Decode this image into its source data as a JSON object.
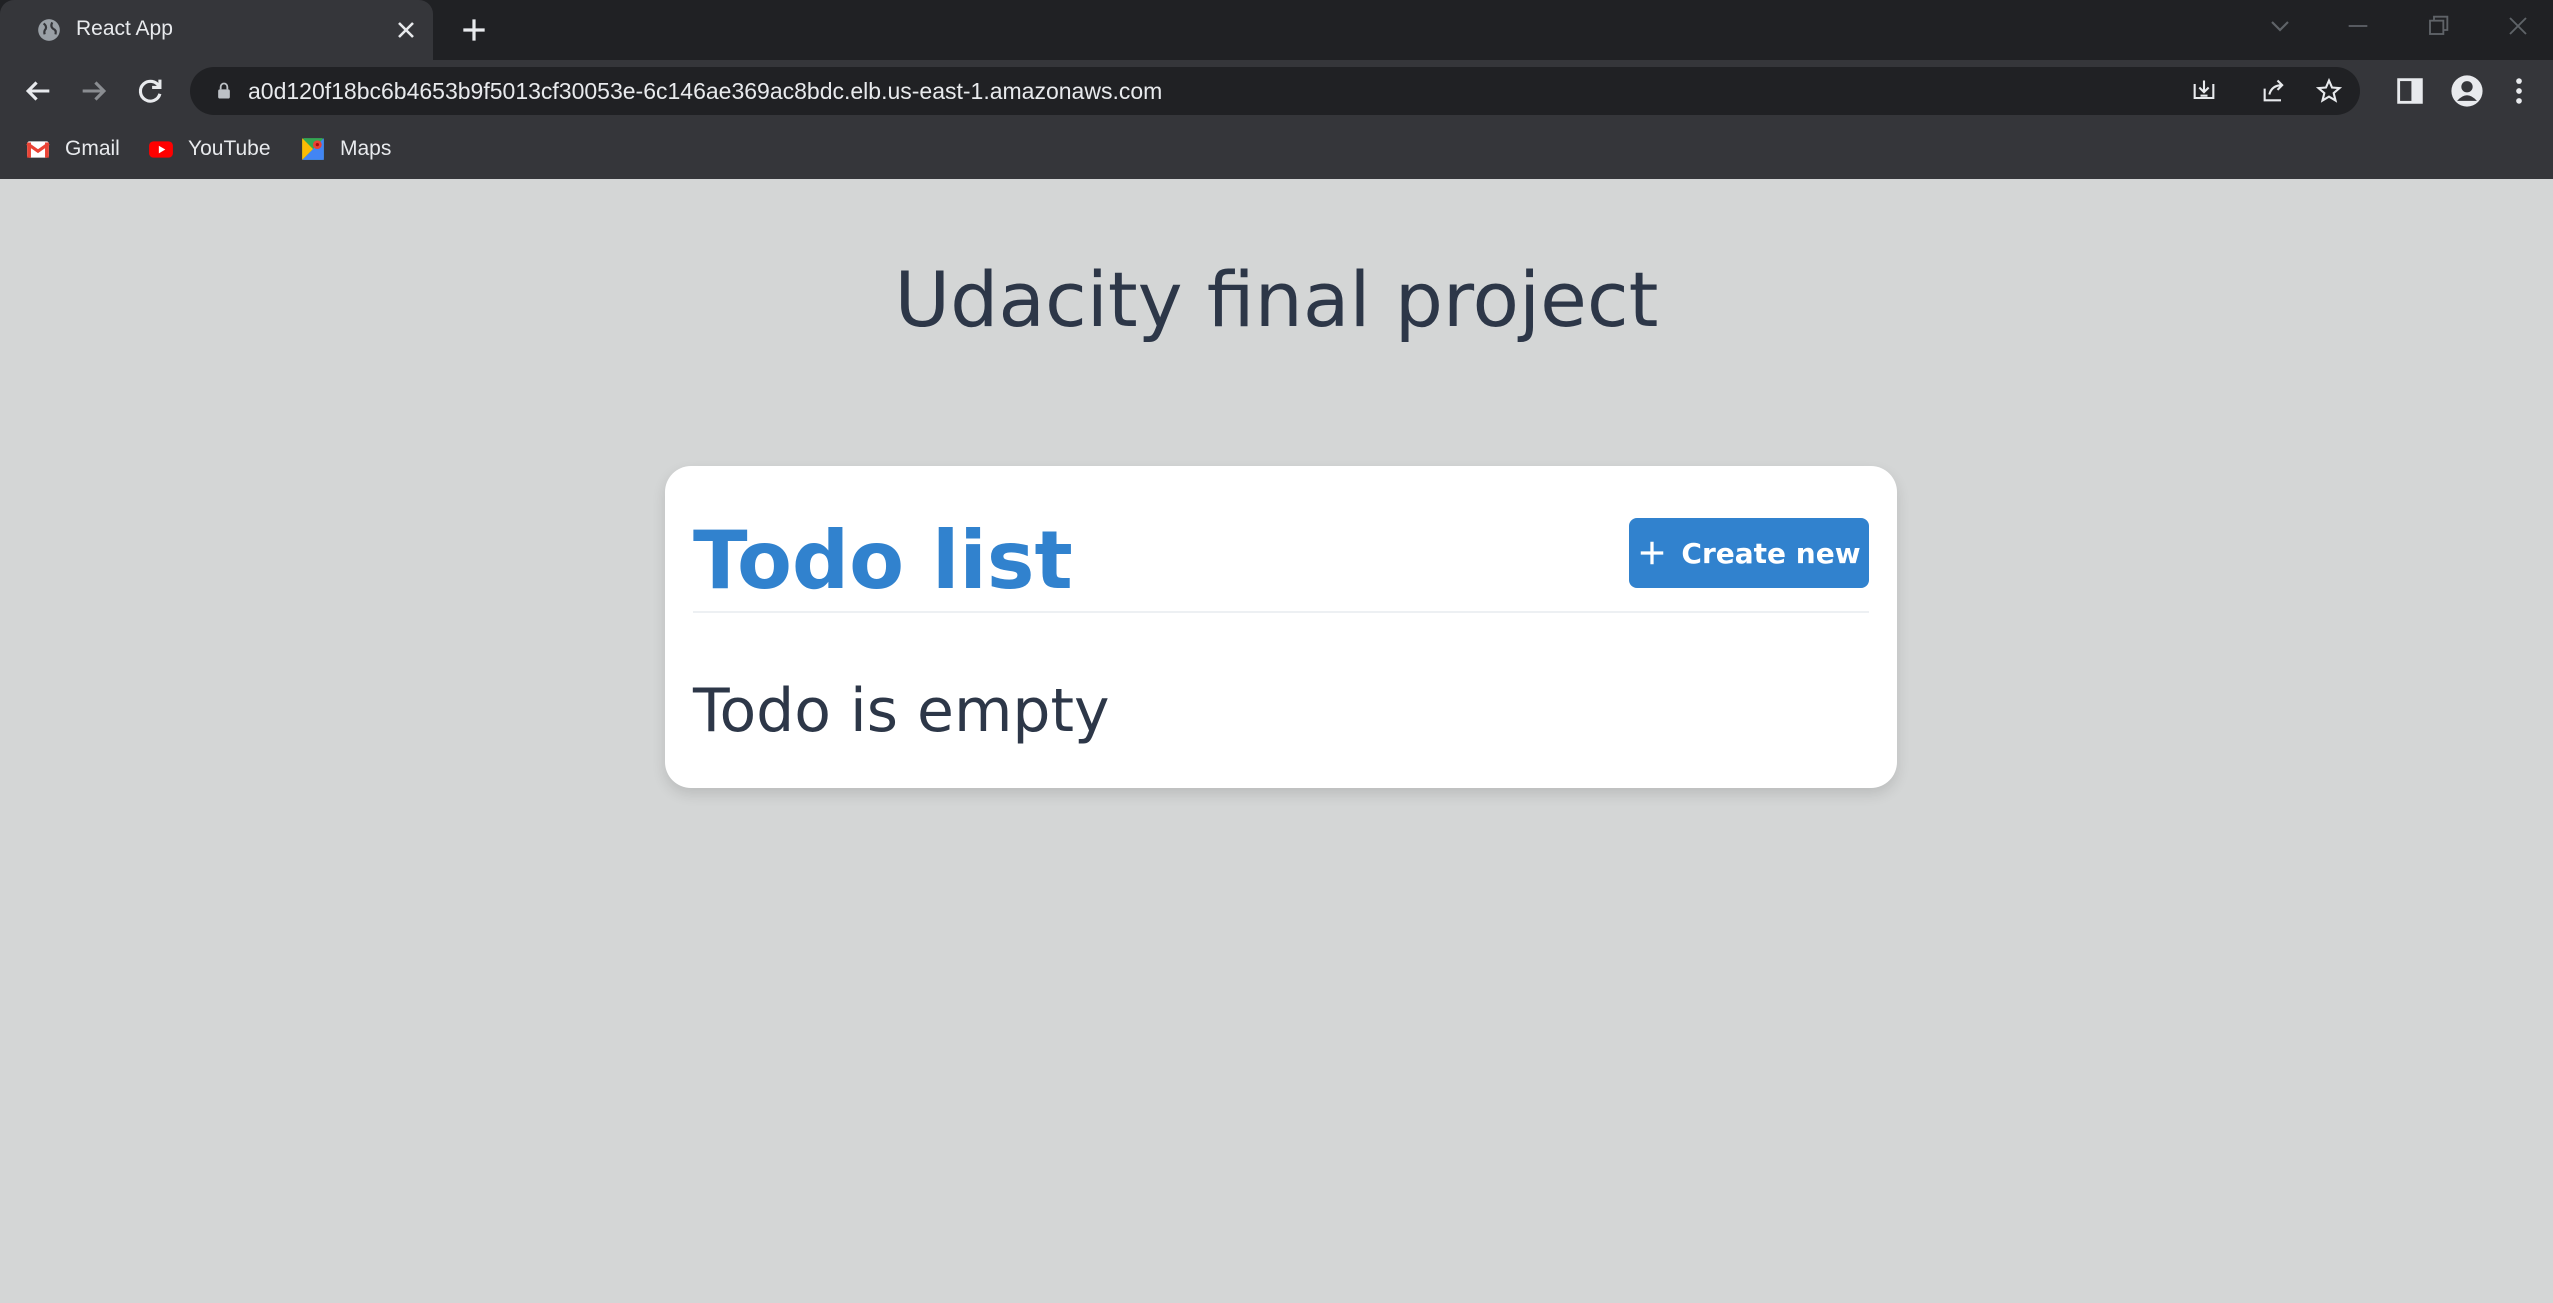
{
  "browser": {
    "tab": {
      "title": "React App",
      "favicon": "globe-icon"
    },
    "address_bar": {
      "url": "a0d120f18bc6b4653b9f5013cf30053e-6c146ae369ac8bdc.elb.us-east-1.amazonaws.com"
    },
    "bookmarks": [
      {
        "label": "Gmail",
        "icon": "gmail-icon"
      },
      {
        "label": "YouTube",
        "icon": "youtube-icon"
      },
      {
        "label": "Maps",
        "icon": "maps-icon"
      }
    ],
    "colors": {
      "tabstrip": "#202124",
      "toolbar": "#35363a"
    }
  },
  "page": {
    "title": "Udacity final project",
    "todo_card": {
      "heading": "Todo list",
      "create_button": {
        "label": "Create new",
        "icon": "plus-icon"
      },
      "empty_message": "Todo is empty"
    },
    "colors": {
      "background": "#d4d6d6",
      "accent": "#3182ce",
      "text": "#2d3748"
    }
  }
}
